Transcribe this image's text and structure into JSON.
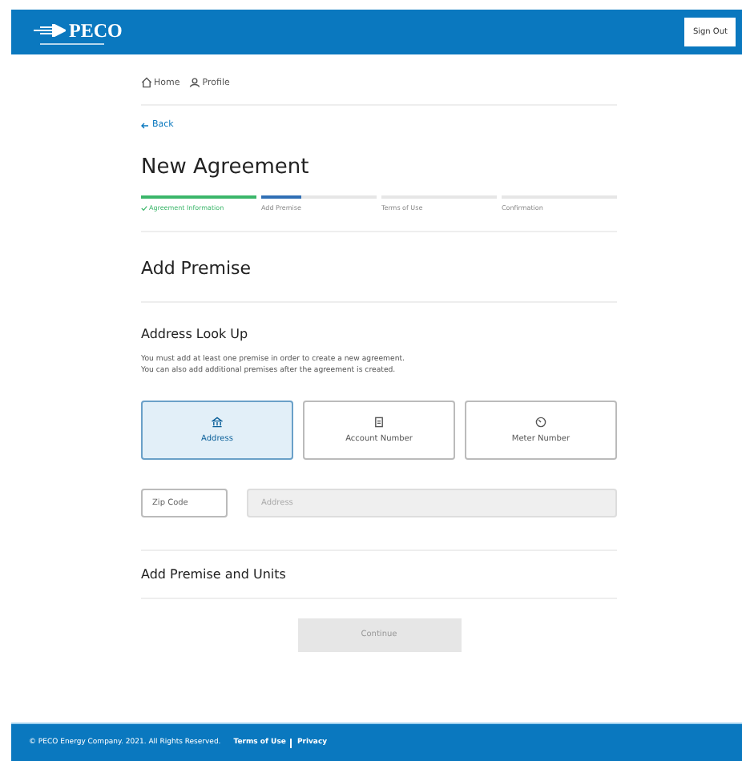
{
  "header": {
    "logo": "PECO",
    "sign_out": "Sign Out"
  },
  "nav": [
    {
      "label": "Home"
    },
    {
      "label": "Profile"
    }
  ],
  "back": "Back",
  "title": "New Agreement",
  "steps": [
    {
      "label": "Agreement Information",
      "kind": "complete"
    },
    {
      "label": "Add Premise",
      "kind": "current"
    },
    {
      "label": "Terms of Use",
      "kind": "upcoming"
    },
    {
      "label": "Confirmation",
      "kind": "upcoming"
    }
  ],
  "section_title": "Add Premise",
  "lookup": {
    "title": "Address Look Up",
    "description": "You must add at least one premise in order to create a new agreement.\nYou can also add additional premises after the agreement is created.",
    "options": [
      {
        "label": "Address",
        "selected": true
      },
      {
        "label": "Account Number",
        "selected": false
      },
      {
        "label": "Meter Number",
        "selected": false
      }
    ],
    "zip": {
      "placeholder": "Zip Code"
    },
    "address": {
      "placeholder": "Address",
      "disabled": true
    }
  },
  "units_title": "Add Premise and Units",
  "continue": {
    "label": "Continue",
    "disabled": true
  },
  "footer": {
    "copyright": "© PECO Energy Company. 2021. All Rights Reserved.",
    "links": [
      "Terms of Use",
      "Privacy"
    ]
  }
}
